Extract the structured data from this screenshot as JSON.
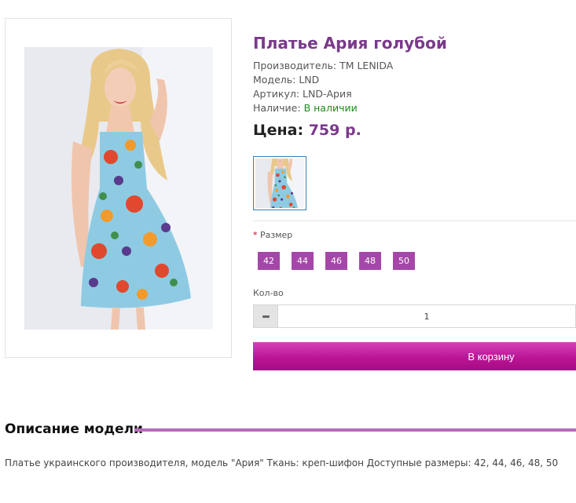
{
  "product": {
    "title": "Платье Ария голубой",
    "manufacturer_label": "Производитель:",
    "manufacturer": "TM LENIDA",
    "model_label": "Модель:",
    "model": "LND",
    "sku_label": "Артикул:",
    "sku": "LND-Ария",
    "availability_label": "Наличие:",
    "availability": "В наличии",
    "price_label": "Цена:",
    "price": "759 р."
  },
  "options": {
    "required_mark": "*",
    "size_label": "Размер",
    "sizes": [
      "42",
      "44",
      "46",
      "48",
      "50"
    ]
  },
  "quantity": {
    "label": "Кол-во",
    "value": "1"
  },
  "cart_button_label": "В корзину",
  "description": {
    "heading": "Описание модели",
    "text": "Платье украинского производителя, модель \"Ария\" Ткань: креп-шифон Доступные размеры: 42, 44, 46, 48, 50"
  },
  "colors": {
    "accent": "#7a3a8a",
    "size_button": "#a547a8",
    "cart_button": "#bb1596",
    "in_stock": "#1a8a1a"
  }
}
